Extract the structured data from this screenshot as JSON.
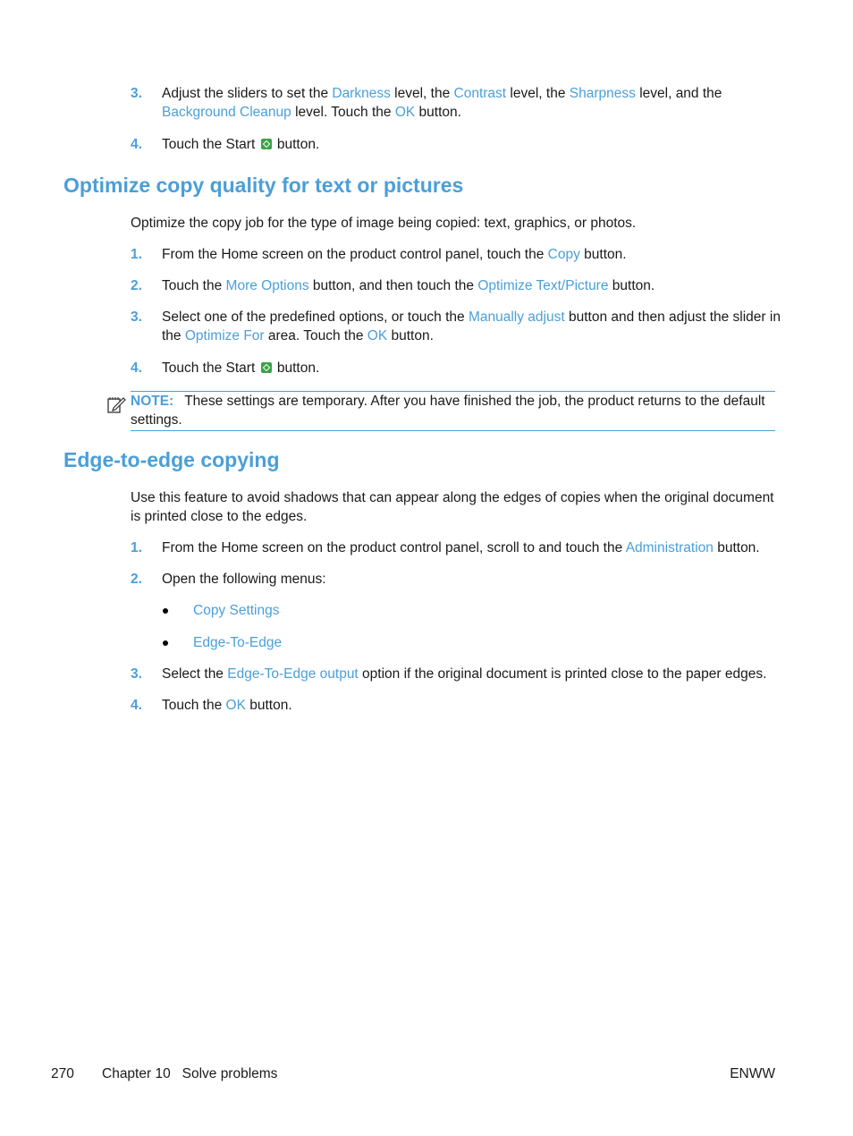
{
  "top_steps": [
    {
      "num": "3.",
      "parts": [
        {
          "t": "Adjust the sliders to set the "
        },
        {
          "t": "Darkness",
          "link": true
        },
        {
          "t": " level, the "
        },
        {
          "t": "Contrast",
          "link": true
        },
        {
          "t": " level, the "
        },
        {
          "t": "Sharpness",
          "link": true
        },
        {
          "t": " level, and the "
        },
        {
          "t": "Background Cleanup",
          "link": true
        },
        {
          "t": " level. Touch the "
        },
        {
          "t": "OK",
          "link": true
        },
        {
          "t": " button."
        }
      ]
    },
    {
      "num": "4.",
      "before": "Touch the Start ",
      "after": " button."
    }
  ],
  "section1": {
    "title": "Optimize copy quality for text or pictures",
    "intro": "Optimize the copy job for the type of image being copied: text, graphics, or photos.",
    "steps": [
      {
        "num": "1.",
        "parts": [
          {
            "t": "From the Home screen on the product control panel, touch the "
          },
          {
            "t": "Copy",
            "link": true
          },
          {
            "t": " button."
          }
        ]
      },
      {
        "num": "2.",
        "parts": [
          {
            "t": "Touch the "
          },
          {
            "t": "More Options",
            "link": true
          },
          {
            "t": " button, and then touch the "
          },
          {
            "t": "Optimize Text/Picture",
            "link": true
          },
          {
            "t": " button."
          }
        ]
      },
      {
        "num": "3.",
        "parts": [
          {
            "t": "Select one of the predefined options, or touch the "
          },
          {
            "t": "Manually adjust",
            "link": true
          },
          {
            "t": " button and then adjust the slider in the "
          },
          {
            "t": "Optimize For",
            "link": true
          },
          {
            "t": " area. Touch the "
          },
          {
            "t": "OK",
            "link": true
          },
          {
            "t": " button."
          }
        ]
      },
      {
        "num": "4.",
        "before": "Touch the Start ",
        "after": " button."
      }
    ],
    "note_label": "NOTE:",
    "note_text": "These settings are temporary. After you have finished the job, the product returns to the default settings."
  },
  "section2": {
    "title": "Edge-to-edge copying",
    "intro": "Use this feature to avoid shadows that can appear along the edges of copies when the original document is printed close to the edges.",
    "steps": [
      {
        "num": "1.",
        "parts": [
          {
            "t": "From the Home screen on the product control panel, scroll to and touch the "
          },
          {
            "t": "Administration",
            "link": true
          },
          {
            "t": " button."
          }
        ]
      },
      {
        "num": "2.",
        "parts": [
          {
            "t": "Open the following menus:"
          }
        ]
      },
      {
        "num": "3.",
        "parts": [
          {
            "t": "Select the "
          },
          {
            "t": "Edge-To-Edge output",
            "link": true
          },
          {
            "t": " option if the original document is printed close to the paper edges."
          }
        ]
      },
      {
        "num": "4.",
        "parts": [
          {
            "t": "Touch the "
          },
          {
            "t": "OK",
            "link": true
          },
          {
            "t": " button."
          }
        ]
      }
    ],
    "menus": [
      "Copy Settings",
      "Edge-To-Edge"
    ]
  },
  "footer": {
    "page_number": "270",
    "chapter": "Chapter 10   Solve problems",
    "right": "ENWW"
  },
  "colors": {
    "accent": "#4a9fd8"
  }
}
